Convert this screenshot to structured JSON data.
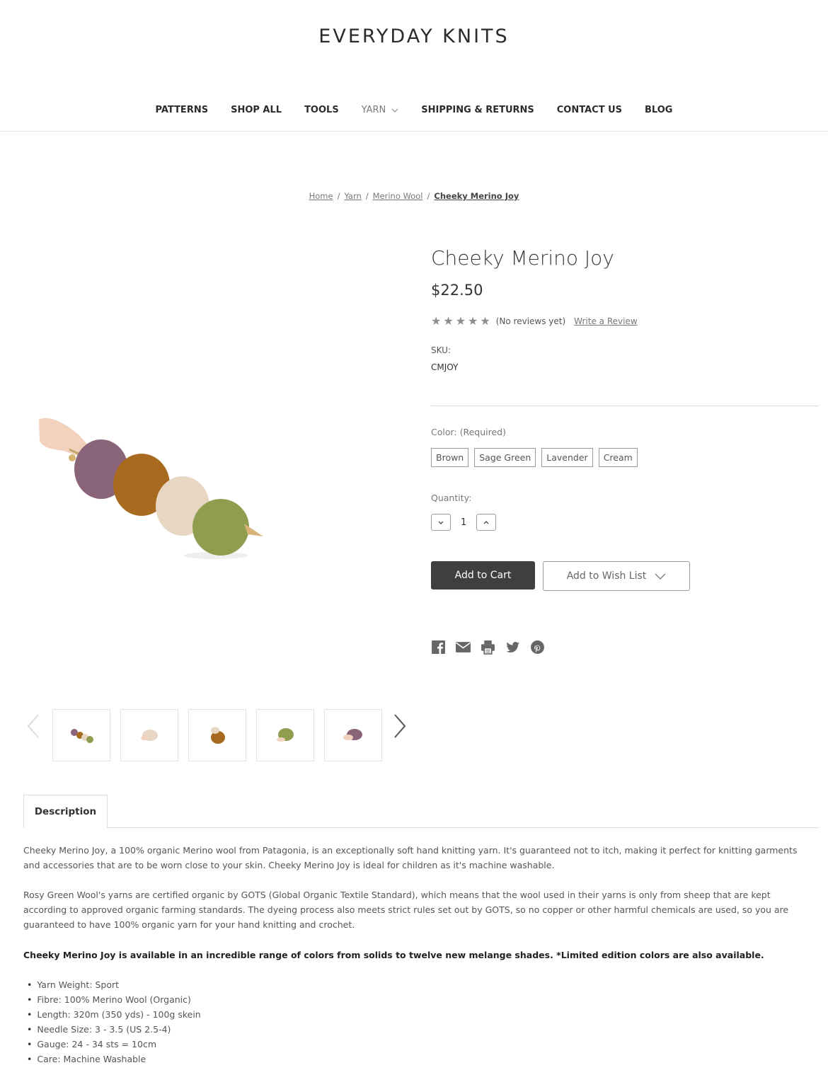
{
  "store": {
    "title": "EVERYDAY KNITS"
  },
  "nav": {
    "items": [
      {
        "label": "PATTERNS"
      },
      {
        "label": "SHOP ALL"
      },
      {
        "label": "TOOLS"
      },
      {
        "label": "YARN"
      },
      {
        "label": "SHIPPING & RETURNS"
      },
      {
        "label": "CONTACT US"
      },
      {
        "label": "BLOG"
      }
    ]
  },
  "breadcrumb": [
    "Home",
    "Yarn",
    "Merino Wool",
    "Cheeky Merino Joy"
  ],
  "product": {
    "title": "Cheeky Merino Joy",
    "price": "$22.50",
    "rating_stars": 5,
    "reviews_text": "(No reviews yet)",
    "write_review": "Write a Review",
    "sku_label": "SKU:",
    "sku": "CMJOY",
    "color_label": "Color:  (Required)",
    "colors": [
      "Brown",
      "Sage Green",
      "Lavender",
      "Cream"
    ],
    "quantity_label": "Quantity:",
    "quantity": "1",
    "add_to_cart": "Add to Cart",
    "add_to_wishlist": "Add to Wish List"
  },
  "share_icons": [
    "facebook-icon",
    "email-icon",
    "print-icon",
    "twitter-icon",
    "pinterest-icon"
  ],
  "thumbnails": [
    "all-skeins",
    "cream-skein",
    "brown-skein",
    "sage-skein",
    "lavender-skein"
  ],
  "colors": {
    "yarn_lavender": "#8a6478",
    "yarn_brown": "#a86a1f",
    "yarn_cream": "#e6d6c2",
    "yarn_sage": "#8f9e4e",
    "button_dark": "#3f3f3f"
  },
  "tabs": {
    "description": "Description"
  },
  "description": {
    "p1": "Cheeky Merino Joy, a 100% organic Merino wool from Patagonia, is an exceptionally soft hand knitting yarn. It's guaranteed not to itch, making it perfect for knitting garments and accessories that are to be worn close to your skin. Cheeky Merino Joy is ideal for children as it's machine washable.",
    "p2": "Rosy Green Wool's yarns are certified organic by GOTS (Global Organic Textile Standard), which means that the wool used in their yarns is only from sheep that are kept according to approved organic farming standards. The dyeing process also meets strict rules set out by GOTS, so no copper or other harmful chemicals are used, so you are guaranteed to have 100% organic yarn for your hand knitting and crochet.",
    "p3": "Cheeky Merino Joy is available in an incredible range of colors from solids to twelve new melange shades. *Limited edition colors are also available.",
    "specs": [
      "Yarn Weight: Sport",
      "Fibre: 100% Merino Wool (Organic)",
      "Length: 320m (350 yds) - 100g skein",
      "Needle Size: 3 - 3.5 (US 2.5-4)",
      "Gauge: 24 - 34 sts = 10cm",
      "Care: Machine Washable"
    ]
  }
}
